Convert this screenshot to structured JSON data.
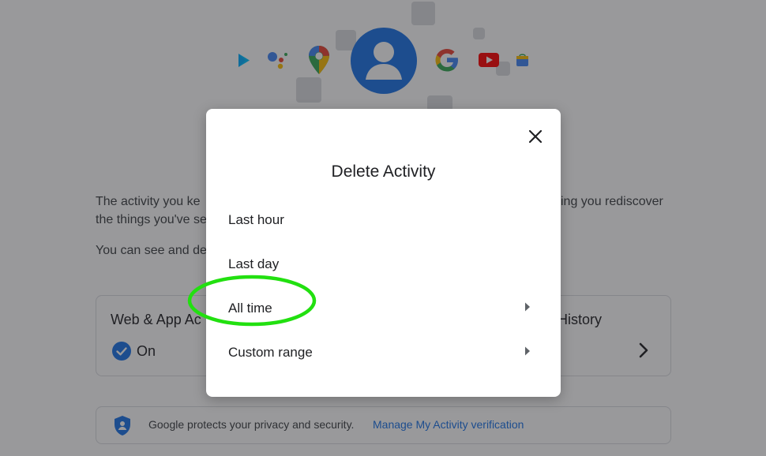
{
  "background": {
    "intro_line1_left": "The activity you ke",
    "intro_line1_right": "ing you rediscover",
    "intro_line2_left": "the things you've se",
    "intro_line3_left": "You can see and de",
    "web_app_card": {
      "title": "Web & App Ac",
      "status": "On"
    },
    "history_card": {
      "title": "History"
    },
    "privacy": {
      "text": "Google protects your privacy and security.",
      "link": "Manage My Activity verification"
    }
  },
  "dialog": {
    "title": "Delete Activity",
    "options": [
      {
        "label": "Last hour",
        "has_arrow": false
      },
      {
        "label": "Last day",
        "has_arrow": false
      },
      {
        "label": "All time",
        "has_arrow": true
      },
      {
        "label": "Custom range",
        "has_arrow": true
      }
    ]
  },
  "annotation": {
    "highlight_color": "#22e010"
  },
  "colors": {
    "google_blue": "#1a73e8",
    "scrim": "rgba(32,33,36,0.46)"
  }
}
